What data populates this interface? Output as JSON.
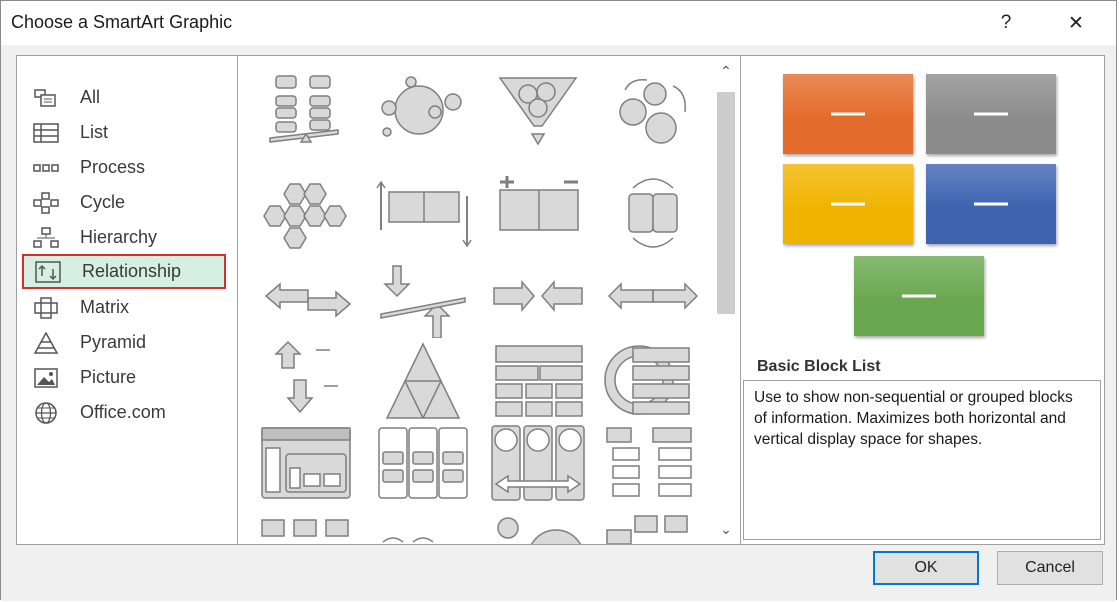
{
  "window": {
    "title": "Choose a SmartArt Graphic",
    "help_glyph": "?",
    "close_glyph": "✕"
  },
  "categories": [
    {
      "label": "All",
      "icon": "all-icon"
    },
    {
      "label": "List",
      "icon": "list-icon"
    },
    {
      "label": "Process",
      "icon": "process-icon"
    },
    {
      "label": "Cycle",
      "icon": "cycle-icon"
    },
    {
      "label": "Hierarchy",
      "icon": "hierarchy-icon"
    },
    {
      "label": "Relationship",
      "icon": "relationship-icon",
      "selected": true
    },
    {
      "label": "Matrix",
      "icon": "matrix-icon"
    },
    {
      "label": "Pyramid",
      "icon": "pyramid-icon"
    },
    {
      "label": "Picture",
      "icon": "picture-icon"
    },
    {
      "label": "Office.com",
      "icon": "globe-icon"
    }
  ],
  "preview": {
    "title": "Basic Block List",
    "description": "Use to show non-sequential or grouped blocks of information. Maximizes both horizontal and vertical display space for shapes.",
    "block_colors": [
      "#e36c2c",
      "#8c8c8c",
      "#f0b400",
      "#3e64b0",
      "#6aa84f"
    ]
  },
  "buttons": {
    "ok": "OK",
    "cancel": "Cancel"
  },
  "colors": {
    "selection_fill": "#d5efe3",
    "selection_border": "#d32f2f",
    "ok_border": "#0078d7"
  }
}
